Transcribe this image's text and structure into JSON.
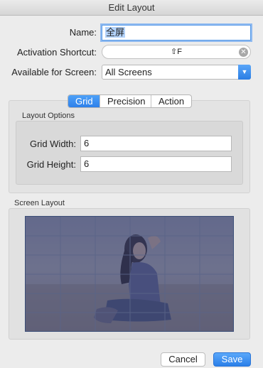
{
  "window": {
    "title": "Edit Layout"
  },
  "form": {
    "name_label": "Name:",
    "name_value": "全屏",
    "shortcut_label": "Activation Shortcut:",
    "shortcut_value": "⇧F",
    "screen_label": "Available for Screen:",
    "screen_value": "All Screens"
  },
  "tabs": [
    {
      "label": "Grid",
      "active": true
    },
    {
      "label": "Precision",
      "active": false
    },
    {
      "label": "Action",
      "active": false
    }
  ],
  "layout_options": {
    "title": "Layout Options",
    "grid_width_label": "Grid Width:",
    "grid_width_value": "6",
    "grid_height_label": "Grid Height:",
    "grid_height_value": "6"
  },
  "screen_layout": {
    "title": "Screen Layout",
    "grid_columns": 6,
    "grid_rows": 6
  },
  "buttons": {
    "cancel": "Cancel",
    "save": "Save"
  },
  "colors": {
    "accent": "#2d80ea",
    "overlay": "#3c4f78"
  }
}
